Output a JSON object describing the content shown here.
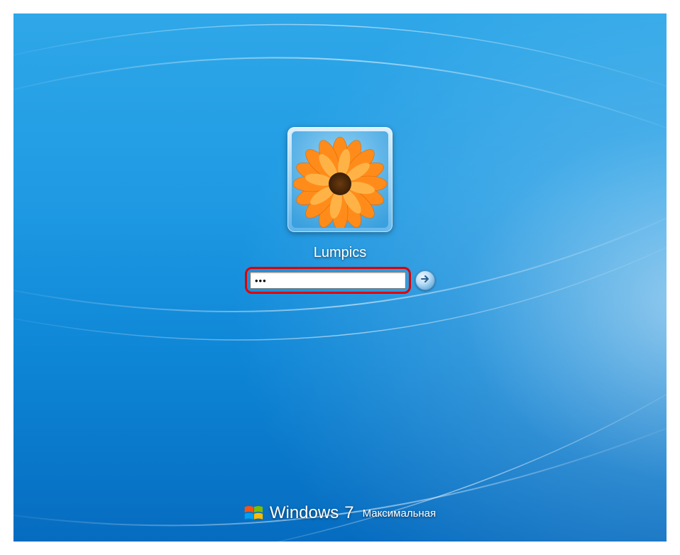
{
  "user": {
    "name": "Lumpics"
  },
  "password": {
    "masked_value": "•••"
  },
  "branding": {
    "product": "Windows",
    "version": "7",
    "edition": "Максимальная"
  },
  "icons": {
    "submit": "arrow-right-circle",
    "logo": "windows-logo"
  },
  "colors": {
    "highlight": "#e00000",
    "accent": "#1f9ae3"
  }
}
